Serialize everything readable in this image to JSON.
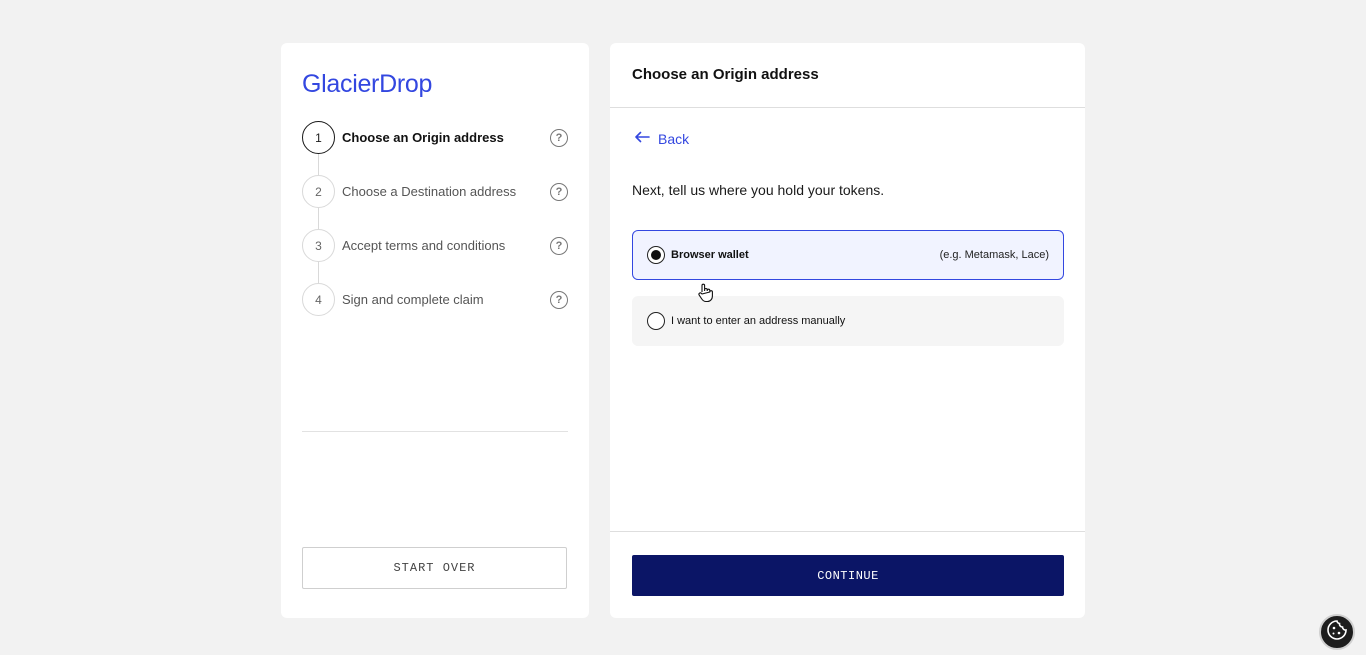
{
  "brand": {
    "logo_text": "GlacierDrop",
    "accent_color": "#3347e0",
    "primary_button_color": "#0b1566"
  },
  "steps": [
    {
      "number": "1",
      "label": "Choose an Origin address",
      "active": true,
      "help_icon": "question-circle-icon"
    },
    {
      "number": "2",
      "label": "Choose a Destination address",
      "active": false,
      "help_icon": "question-circle-icon"
    },
    {
      "number": "3",
      "label": "Accept terms and conditions",
      "active": false,
      "help_icon": "question-circle-icon"
    },
    {
      "number": "4",
      "label": "Sign and complete claim",
      "active": false,
      "help_icon": "question-circle-icon"
    }
  ],
  "help_glyph": "?",
  "left_panel": {
    "start_over_label": "START OVER"
  },
  "main": {
    "title": "Choose an Origin address",
    "back_label": "Back",
    "back_icon": "arrow-left-icon",
    "prompt": "Next, tell us where you hold your tokens.",
    "options": [
      {
        "label": "Browser wallet",
        "hint": "(e.g. Metamask, Lace)",
        "selected": true
      },
      {
        "label": "I want to enter an address manually",
        "hint": "",
        "selected": false
      }
    ],
    "continue_label": "CONTINUE"
  },
  "cookie_icon": "cookie-icon"
}
